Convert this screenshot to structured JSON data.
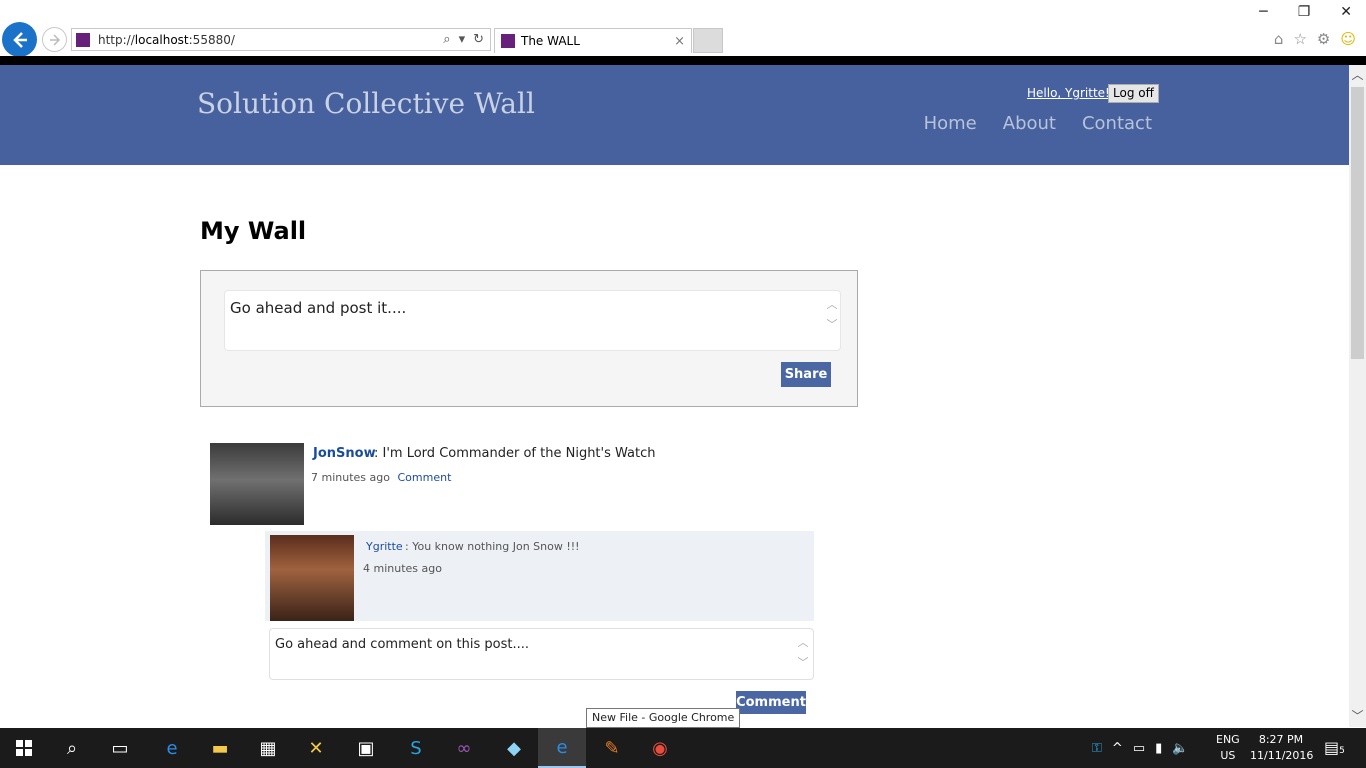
{
  "browser": {
    "url_prefix": "http://",
    "url_host": "localhost",
    "url_rest": ":55880/",
    "tab_title": "The WALL",
    "tab_close": "×",
    "controls": {
      "minimize": "─",
      "restore": "❐",
      "close": "✕"
    }
  },
  "site": {
    "brand": "Solution Collective Wall",
    "greeting": "Hello, Ygritte!",
    "logoff_label": "Log off",
    "nav": [
      "Home",
      "About",
      "Contact"
    ]
  },
  "wall": {
    "title": "My Wall",
    "post_placeholder": "Go ahead and post it....",
    "share_label": "Share"
  },
  "posts": [
    {
      "author": "JonSnow",
      "separator": " : ",
      "text": "I'm Lord Commander of the Night's Watch",
      "time": "7 minutes ago",
      "comment_link": "Comment",
      "comments": [
        {
          "author": "Ygritte",
          "text": "You know nothing Jon Snow !!!",
          "time": "4 minutes ago"
        }
      ],
      "comment_placeholder": "Go ahead and comment on this post....",
      "comment_button": "Comment"
    }
  ],
  "tooltip": "New File - Google Chrome",
  "taskbar": {
    "lang_line1": "ENG",
    "lang_line2": "US",
    "time": "8:27 PM",
    "date": "11/11/2016",
    "notify_count": "5"
  }
}
